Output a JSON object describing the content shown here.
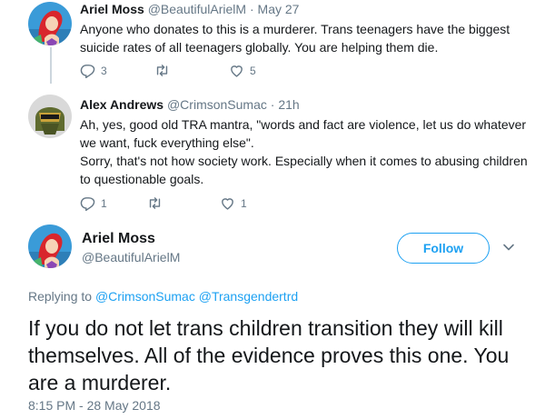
{
  "tweets": [
    {
      "name": "Ariel Moss",
      "handle": "@BeautifulArielM",
      "separator": "·",
      "time": "May 27",
      "text": "Anyone who donates to this is a murderer. Trans teenagers have the biggest suicide rates of all teenagers globally. You are helping them die.",
      "reply_count": "3",
      "retweet_count": "",
      "like_count": "5",
      "avatar_icon": "mermaid-avatar"
    },
    {
      "name": "Alex Andrews",
      "handle": "@CrimsonSumac",
      "separator": "·",
      "time": "21h",
      "text_lines": [
        "Ah, yes, good old TRA mantra, \"words and fact are violence, let us do whatever we want, fuck everything else\".",
        "Sorry, that's not how society work. Especially when it comes to abusing children to questionable goals."
      ],
      "reply_count": "1",
      "retweet_count": "",
      "like_count": "1",
      "avatar_icon": "helmet-avatar"
    }
  ],
  "main_tweet": {
    "name": "Ariel Moss",
    "handle": "@BeautifulArielM",
    "follow_label": "Follow",
    "replying_prefix": "Replying to",
    "replying_to_1": "@CrimsonSumac",
    "replying_to_2": "@Transgendertrd",
    "text": "If you do not let trans children transition they will kill themselves. All of the evidence proves this one. You are a murderer.",
    "timestamp": "8:15 PM - 28 May 2018"
  },
  "colors": {
    "accent": "#1da1f2",
    "muted": "#657786",
    "text": "#14171a",
    "thread_line": "#ccd6dd"
  }
}
